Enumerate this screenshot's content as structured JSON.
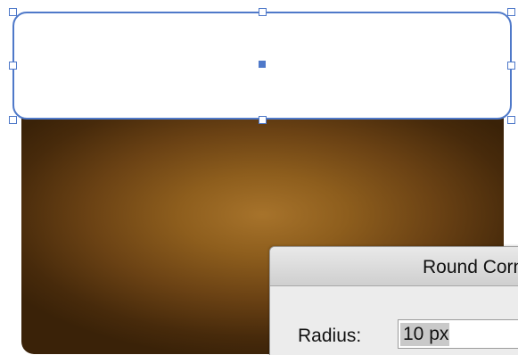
{
  "dialog": {
    "title": "Round Corners",
    "radius_label": "Radius:",
    "radius_value": "10 px"
  },
  "colors": {
    "selection": "#4f79c9",
    "gradient_center": "#a7732b",
    "gradient_edge": "#3a2208",
    "dialog_bg": "#ececec"
  }
}
